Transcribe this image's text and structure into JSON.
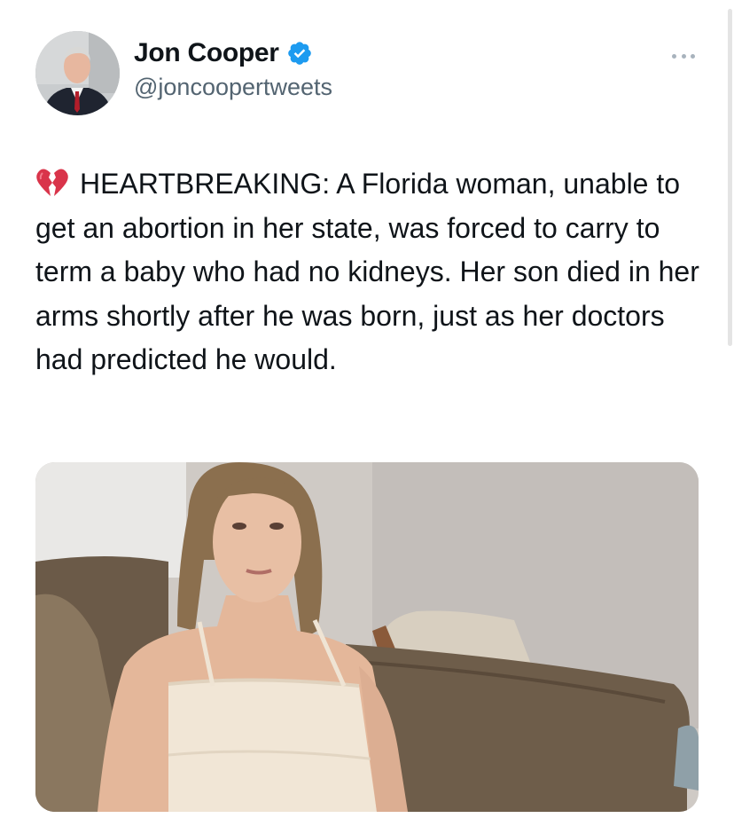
{
  "tweet": {
    "author": {
      "display_name": "Jon Cooper",
      "handle": "@joncoopertweets",
      "verified": true,
      "verified_color": "#1d9bf0"
    },
    "emoji": "broken-heart-icon",
    "text": "HEARTBREAKING: A Florida woman, unable to get an abortion in her state, was forced to carry to term a baby who had no kidneys. Her son died in her arms shortly after he was born, just as her doctors had predicted he would.",
    "media": {
      "kind": "photo"
    }
  },
  "colors": {
    "text_primary": "#0f1419",
    "text_secondary": "#536471",
    "accent": "#1d9bf0"
  }
}
